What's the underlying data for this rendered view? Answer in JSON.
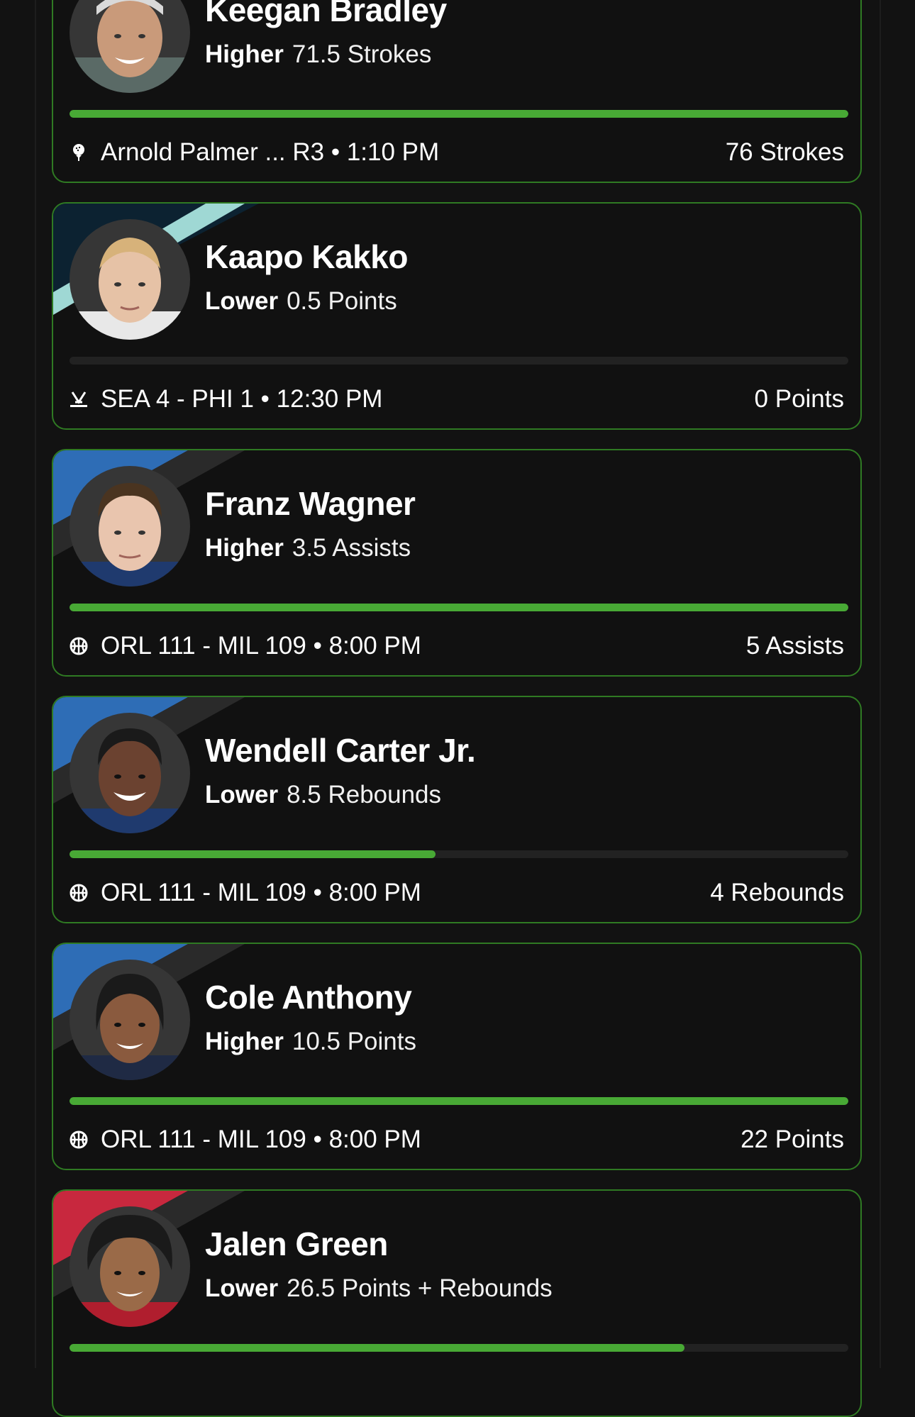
{
  "colors": {
    "background": "#121212",
    "card_border": "#2f7a23",
    "progress_fill": "#48a935",
    "progress_track": "#222222"
  },
  "picks": [
    {
      "player": "Keegan Bradley",
      "direction": "Higher",
      "line": "71.5 Strokes",
      "progress_fraction": 1.0,
      "game": "Arnold Palmer ... R3 • 1:10 PM",
      "result": "76 Strokes",
      "sport_icon": "golf-icon",
      "team_colors": [
        "#111111",
        "#111111"
      ]
    },
    {
      "player": "Kaapo Kakko",
      "direction": "Lower",
      "line": "0.5 Points",
      "progress_fraction": 0.0,
      "game": "SEA 4 - PHI 1 • 12:30 PM",
      "result": "0 Points",
      "sport_icon": "hockey-icon",
      "team_colors": [
        "#0c2231",
        "#9fd8d4"
      ]
    },
    {
      "player": "Franz Wagner",
      "direction": "Higher",
      "line": "3.5 Assists",
      "progress_fraction": 1.0,
      "game": "ORL 111 - MIL 109 • 8:00 PM",
      "result": "5 Assists",
      "sport_icon": "basketball-icon",
      "team_colors": [
        "#2e6db6",
        "#2a2a2a"
      ]
    },
    {
      "player": "Wendell Carter Jr.",
      "direction": "Lower",
      "line": "8.5 Rebounds",
      "progress_fraction": 0.47,
      "game": "ORL 111 - MIL 109 • 8:00 PM",
      "result": "4 Rebounds",
      "sport_icon": "basketball-icon",
      "team_colors": [
        "#2e6db6",
        "#2a2a2a"
      ]
    },
    {
      "player": "Cole Anthony",
      "direction": "Higher",
      "line": "10.5 Points",
      "progress_fraction": 1.0,
      "game": "ORL 111 - MIL 109 • 8:00 PM",
      "result": "22 Points",
      "sport_icon": "basketball-icon",
      "team_colors": [
        "#2e6db6",
        "#2a2a2a"
      ]
    },
    {
      "player": "Jalen Green",
      "direction": "Lower",
      "line": "26.5 Points + Rebounds",
      "progress_fraction": 0.79,
      "game": "",
      "result": "",
      "sport_icon": "basketball-icon",
      "team_colors": [
        "#c8283e",
        "#2a2a2a"
      ]
    }
  ]
}
